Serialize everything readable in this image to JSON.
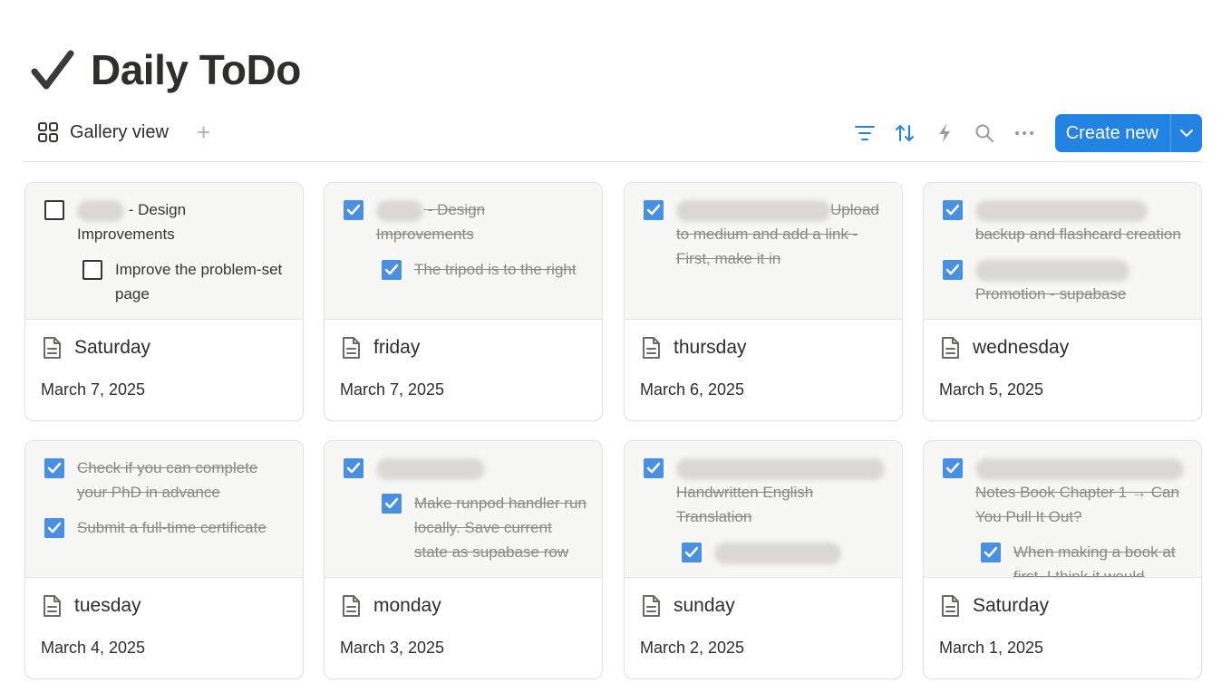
{
  "page": {
    "title": "Daily ToDo",
    "view_label": "Gallery view",
    "create_label": "Create new",
    "accent": "#2383e2",
    "check_color": "#4a90e2"
  },
  "cards": [
    {
      "name": "Saturday",
      "date": "March 7, 2025",
      "todos": [
        {
          "blur": 52,
          "text": " - Design Improvements",
          "done": false,
          "indent": 0
        },
        {
          "text": "Improve the problem-set page",
          "done": false,
          "indent": 1
        }
      ]
    },
    {
      "name": "friday",
      "date": "March 7, 2025",
      "todos": [
        {
          "blur": 52,
          "text": " - Design Improvements",
          "done": true,
          "indent": 0
        },
        {
          "text": "The tripod is to the right",
          "done": true,
          "indent": 1
        }
      ]
    },
    {
      "name": "thursday",
      "date": "March 6, 2025",
      "todos": [
        {
          "blur": 170,
          "text": "Upload to medium and add a link - First, make it in",
          "done": true,
          "indent": 0
        }
      ]
    },
    {
      "name": "wednesday",
      "date": "March 5, 2025",
      "todos": [
        {
          "blur": 190,
          "text": "backup and flashcard creation",
          "done": true,
          "indent": 0
        },
        {
          "blur": 170,
          "text": "Promotion - supabase",
          "done": true,
          "indent": 0
        }
      ]
    },
    {
      "name": "tuesday",
      "date": "March 4, 2025",
      "todos": [
        {
          "text": "Check if you can complete your PhD in advance",
          "done": true,
          "indent": 0
        },
        {
          "text": "Submit a full-time certificate",
          "done": true,
          "indent": 0
        }
      ]
    },
    {
      "name": "monday",
      "date": "March 3, 2025",
      "todos": [
        {
          "blur": 120,
          "text": "",
          "done": true,
          "indent": 0
        },
        {
          "text": "Make runpod handler run locally. Save current state as supabase row",
          "done": true,
          "indent": 1
        }
      ]
    },
    {
      "name": "sunday",
      "date": "March 2, 2025",
      "todos": [
        {
          "blur": 230,
          "text": "Handwritten English Translation",
          "done": true,
          "indent": 0
        },
        {
          "blur": 140,
          "text": "",
          "done": true,
          "indent": 1
        }
      ]
    },
    {
      "name": "Saturday",
      "date": "March 1, 2025",
      "todos": [
        {
          "blur": 230,
          "text": "Notes Book Chapter 1 → Can You Pull It Out?",
          "done": true,
          "indent": 0
        },
        {
          "text": "When making a book at first, I think it would",
          "done": true,
          "indent": 1
        }
      ]
    }
  ]
}
